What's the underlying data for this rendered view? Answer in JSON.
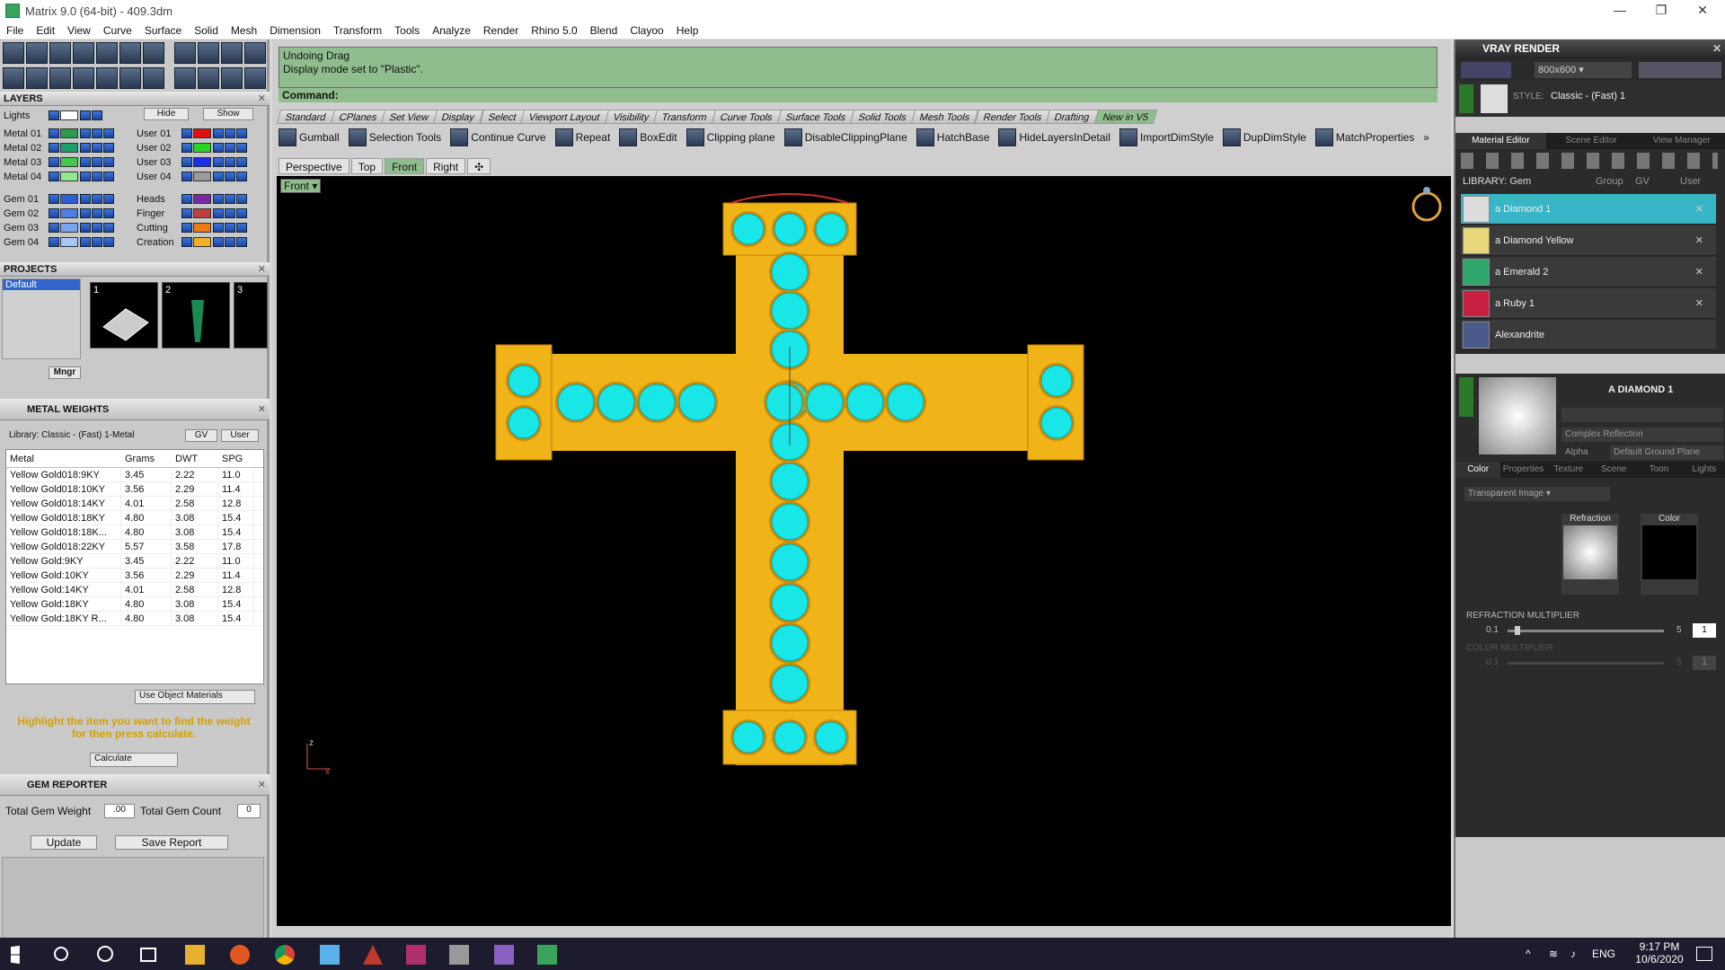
{
  "window": {
    "title": "Matrix 9.0 (64-bit) - 409.3dm"
  },
  "menu": [
    "File",
    "Edit",
    "View",
    "Curve",
    "Surface",
    "Solid",
    "Mesh",
    "Dimension",
    "Transform",
    "Tools",
    "Analyze",
    "Render",
    "Rhino 5.0",
    "Blend",
    "Clayoo",
    "Help"
  ],
  "layers": {
    "title": "LAYERS",
    "lights_label": "Lights",
    "hide_label": "Hide",
    "show_label": "Show",
    "left_items": [
      {
        "label": "Metal 01",
        "color": "#2e9a4e"
      },
      {
        "label": "Metal 02",
        "color": "#1aa06a"
      },
      {
        "label": "Metal 03",
        "color": "#45c84f"
      },
      {
        "label": "Metal 04",
        "color": "#90e890"
      },
      {
        "label": "Gem 01",
        "color": "#2d5fce"
      },
      {
        "label": "Gem 02",
        "color": "#4f7fe0"
      },
      {
        "label": "Gem 03",
        "color": "#76a6f0"
      },
      {
        "label": "Gem 04",
        "color": "#a6c6f6"
      }
    ],
    "right_items": [
      {
        "label": "User 01",
        "color": "#e01010"
      },
      {
        "label": "User 02",
        "color": "#22d622"
      },
      {
        "label": "User 03",
        "color": "#1a2fe8"
      },
      {
        "label": "User 04",
        "color": "#9a9a9a"
      },
      {
        "label": "Heads",
        "color": "#7a2aa0"
      },
      {
        "label": "Finger",
        "color": "#c04040"
      },
      {
        "label": "Cutting",
        "color": "#ee7a14"
      },
      {
        "label": "Creation",
        "color": "#f2b024"
      }
    ]
  },
  "projects": {
    "title": "PROJECTS",
    "items": [
      "Default"
    ],
    "slots": [
      "1",
      "2",
      "3"
    ],
    "mngr": "Mngr"
  },
  "metal_weights": {
    "title": "METAL WEIGHTS",
    "library": "Library: Classic - (Fast) 1-Metal",
    "gv": "GV",
    "user": "User",
    "headers": [
      "Metal",
      "Grams",
      "DWT",
      "SPG"
    ],
    "rows": [
      [
        "Yellow Gold018:9KY",
        "3.45",
        "2.22",
        "11.0"
      ],
      [
        "Yellow Gold018:10KY",
        "3.56",
        "2.29",
        "11.4"
      ],
      [
        "Yellow Gold018:14KY",
        "4.01",
        "2.58",
        "12.8"
      ],
      [
        "Yellow Gold018:18KY",
        "4.80",
        "3.08",
        "15.4"
      ],
      [
        "Yellow Gold018:18K...",
        "4.80",
        "3.08",
        "15.4"
      ],
      [
        "Yellow Gold018:22KY",
        "5.57",
        "3.58",
        "17.8"
      ],
      [
        "Yellow Gold:9KY",
        "3.45",
        "2.22",
        "11.0"
      ],
      [
        "Yellow Gold:10KY",
        "3.56",
        "2.29",
        "11.4"
      ],
      [
        "Yellow Gold:14KY",
        "4.01",
        "2.58",
        "12.8"
      ],
      [
        "Yellow Gold:18KY",
        "4.80",
        "3.08",
        "15.4"
      ],
      [
        "Yellow Gold:18KY R...",
        "4.80",
        "3.08",
        "15.4"
      ]
    ],
    "use_object_materials": "Use Object Materials",
    "hint": "Highlight the item you want to find the weight for then press calculate.",
    "calculate": "Calculate"
  },
  "gem_reporter": {
    "title": "GEM REPORTER",
    "weight_label": "Total Gem Weight",
    "weight_value": ".00",
    "count_label": "Total Gem Count",
    "count_value": "0",
    "update": "Update",
    "save": "Save Report"
  },
  "command": {
    "line1": "Undoing Drag",
    "line2": "Display mode set to \"Plastic\".",
    "prompt": "Command:"
  },
  "tabs": [
    "Standard",
    "CPlanes",
    "Set View",
    "Display",
    "Select",
    "Viewport Layout",
    "Visibility",
    "Transform",
    "Curve Tools",
    "Surface Tools",
    "Solid Tools",
    "Mesh Tools",
    "Render Tools",
    "Drafting",
    "New in V5"
  ],
  "active_tab": "New in V5",
  "tools": [
    "Gumball",
    "Selection Tools",
    "Continue Curve",
    "Repeat",
    "BoxEdit",
    "Clipping plane",
    "DisableClippingPlane",
    "HatchBase",
    "HideLayersInDetail",
    "ImportDimStyle",
    "DupDimStyle",
    "MatchProperties"
  ],
  "viewport_tabs": [
    "Perspective",
    "Top",
    "Front",
    "Right"
  ],
  "active_viewport": "Front",
  "viewport_label": "Front",
  "axis": {
    "z": "z",
    "x": "x"
  },
  "vray": {
    "title": "VRAY RENDER",
    "resolution": "800x600",
    "style_label": "STYLE:",
    "style_value": "Classic - (Fast) 1",
    "tabs": [
      "Material Editor",
      "Scene Editor",
      "View Manager"
    ],
    "library_label": "LIBRARY: Gem",
    "group": "Group",
    "gv": "GV",
    "user": "User",
    "materials": [
      {
        "name": "a Diamond 1",
        "color": "#dcdcdc"
      },
      {
        "name": "a Diamond Yellow",
        "color": "#e8d67a"
      },
      {
        "name": "a Emerald 2",
        "color": "#2ea86a"
      },
      {
        "name": "a Ruby 1",
        "color": "#c82040"
      },
      {
        "name": "Alexandrite",
        "color": "#4a5a8a"
      }
    ],
    "selected_material": "A DIAMOND 1",
    "reflection": "Complex Reflection",
    "alpha": "Alpha",
    "ground": "Default Ground Plane",
    "subtabs": [
      "Color",
      "Properties",
      "Texture",
      "Scene",
      "Toon",
      "Lights"
    ],
    "image_mode": "Transparent Image",
    "refraction_label": "Refraction",
    "color_label": "Color",
    "refraction_multiplier": "REFRACTION MULTIPLIER",
    "color_multiplier": "COLOR MULTIPLIER",
    "slider_min": "0.1",
    "slider_max": "5",
    "slider_value": "1"
  },
  "taskbar": {
    "language": "ENG",
    "time": "9:17 PM",
    "date": "10/6/2020"
  }
}
